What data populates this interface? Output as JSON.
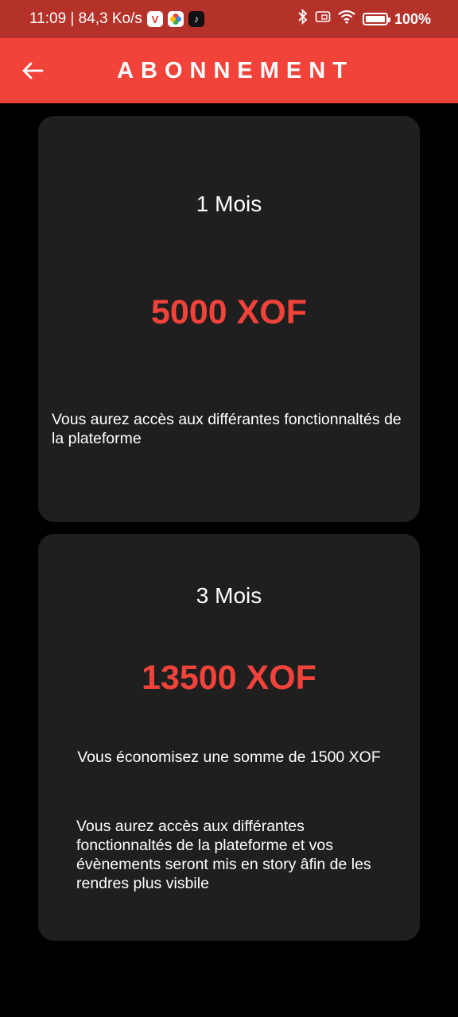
{
  "status_bar": {
    "time_speed": "11:09 | 84,3 Ko/s",
    "app_icons": [
      "vivaldi-icon",
      "google-photos-icon",
      "tiktok-icon"
    ],
    "battery": "100%"
  },
  "app_bar": {
    "title": "ABONNEMENT",
    "background_color": "#f2433b"
  },
  "plans": [
    {
      "duration": "1 Mois",
      "price": "5000 XOF",
      "description": "Vous aurez accès aux différantes fonctionnaltés de la plateforme"
    },
    {
      "duration": "3 Mois",
      "price": "13500 XOF",
      "savings": "Vous économisez une somme de 1500 XOF",
      "description": "Vous aurez accès aux différantes fonctionnaltés de la plateforme et vos évènements seront mis en story âfin de les rendres plus visbile"
    }
  ],
  "colors": {
    "accent": "#f2433b",
    "status_bar": "#b5322b",
    "card": "#1f1f1f",
    "background": "#000000"
  }
}
